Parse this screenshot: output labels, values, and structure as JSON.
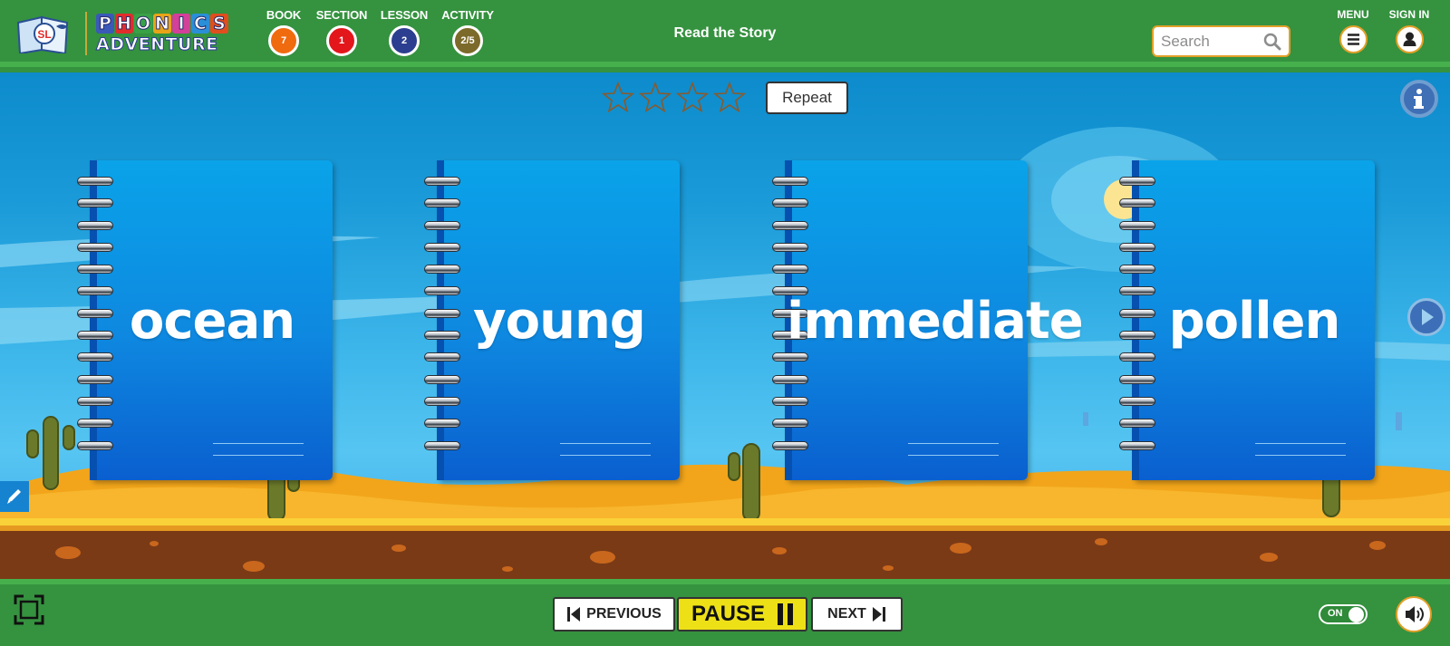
{
  "header": {
    "logo": {
      "phonics": [
        "P",
        "H",
        "O",
        "N",
        "I",
        "C",
        "S"
      ],
      "phonics_colors": [
        "#3a59b8",
        "#e22c2c",
        "#38a246",
        "#e8a418",
        "#d43f9a",
        "#2a8fd6",
        "#e04e1e"
      ],
      "adventure": "ADVENTURE",
      "badge": "SL"
    },
    "breadcrumbs": [
      {
        "label": "BOOK",
        "value": "7",
        "color": "#f06a0e"
      },
      {
        "label": "SECTION",
        "value": "1",
        "color": "#e3161b"
      },
      {
        "label": "LESSON",
        "value": "2",
        "color": "#2c3e8f"
      },
      {
        "label": "ACTIVITY",
        "value": "2/5",
        "color": "#7c6a2a"
      }
    ],
    "title": "Read the Story",
    "search": {
      "placeholder": "Search",
      "value": ""
    },
    "menu_label": "MENU",
    "signin_label": "SIGN IN"
  },
  "activity": {
    "rating": {
      "stars_filled": 0,
      "stars_total": 4
    },
    "repeat_label": "Repeat",
    "words": [
      "ocean",
      "young",
      "immediate",
      "pollen"
    ]
  },
  "footer": {
    "previous_label": "PREVIOUS",
    "pause_label": "PAUSE",
    "next_label": "NEXT",
    "toggle_label": "ON",
    "toggle_state": "on"
  },
  "icons": [
    "logo-book-icon",
    "search-icon",
    "menu-icon",
    "user-icon",
    "info-icon",
    "next-arrow-icon",
    "pencil-icon",
    "fullscreen-icon",
    "previous-icon",
    "pause-icon",
    "next-icon",
    "volume-icon",
    "star-icon"
  ]
}
